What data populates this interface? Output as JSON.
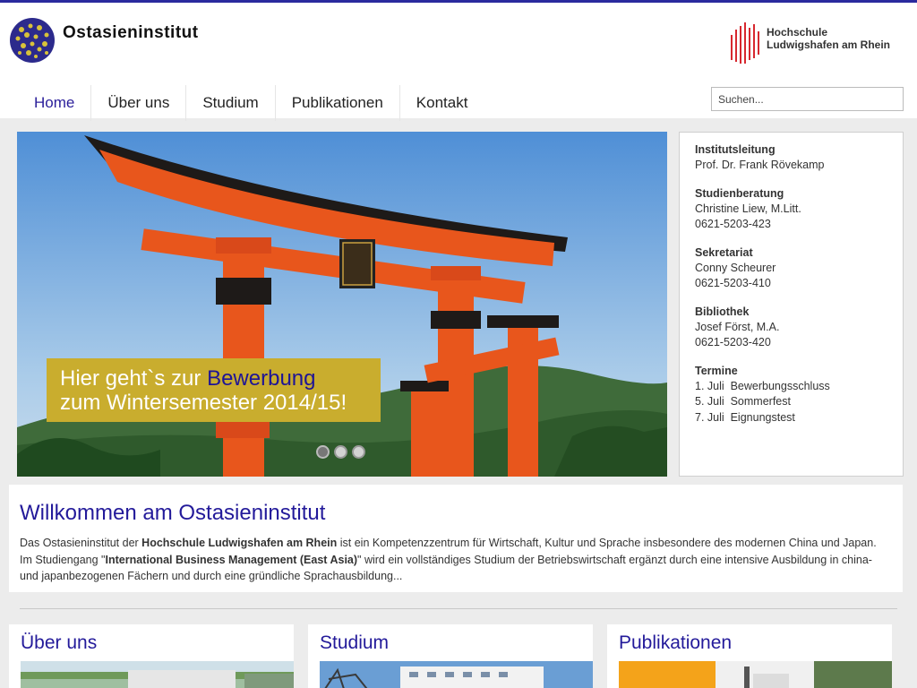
{
  "header": {
    "logo_text": "Ostasieninstitut",
    "partner_logo": {
      "line1": "Hochschule",
      "line2": "Ludwigshafen am Rhein"
    }
  },
  "nav": {
    "items": [
      {
        "label": "Home",
        "active": true
      },
      {
        "label": "Über uns"
      },
      {
        "label": "Studium"
      },
      {
        "label": "Publikationen"
      },
      {
        "label": "Kontakt"
      }
    ]
  },
  "search": {
    "placeholder": "Suchen..."
  },
  "hero": {
    "caption_plain1": "Hier geht`s zur ",
    "caption_highlight": "Bewerbung",
    "caption_line2": "zum Wintersemester 2014/15!",
    "slides": 3,
    "active_slide": 0
  },
  "contacts": [
    {
      "title": "Institutsleitung",
      "lines": [
        "Prof. Dr. Frank Rövekamp"
      ]
    },
    {
      "title": "Studienberatung",
      "lines": [
        "Christine Liew, M.Litt.",
        "0621-5203-423"
      ]
    },
    {
      "title": "Sekretariat",
      "lines": [
        "Conny Scheurer",
        "0621-5203-410"
      ]
    },
    {
      "title": "Bibliothek",
      "lines": [
        "Josef Först, M.A.",
        "0621-5203-420"
      ]
    },
    {
      "title": "Termine",
      "lines": [
        "1. Juli  Bewerbungsschluss",
        "5. Juli  Sommerfest",
        "7. Juli  Eignungstest"
      ]
    }
  ],
  "welcome": {
    "title": "Willkommen am Ostasieninstitut",
    "p1": "Das Ostasieninstitut der ",
    "b1": "Hochschule Ludwigshafen am Rhein",
    "p2": " ist ein Kompetenzzentrum für Wirtschaft, Kultur und Sprache insbesondere des modernen China und Japan. Im Studiengang \"",
    "b2": "International Business Management (East Asia)",
    "p3": "\" wird ein vollständiges Studium der Betriebswirtschaft ergänzt durch eine intensive Ausbildung in china- und japanbezogenen Fächern und durch eine gründliche Sprachausbildung..."
  },
  "teasers": [
    {
      "title": "Über uns"
    },
    {
      "title": "Studium"
    },
    {
      "title": "Publikationen"
    }
  ],
  "colors": {
    "accent": "#231a9a",
    "caption_bg": "#c9ad2e",
    "torii": "#e8561c",
    "partner_red": "#d7282f"
  }
}
